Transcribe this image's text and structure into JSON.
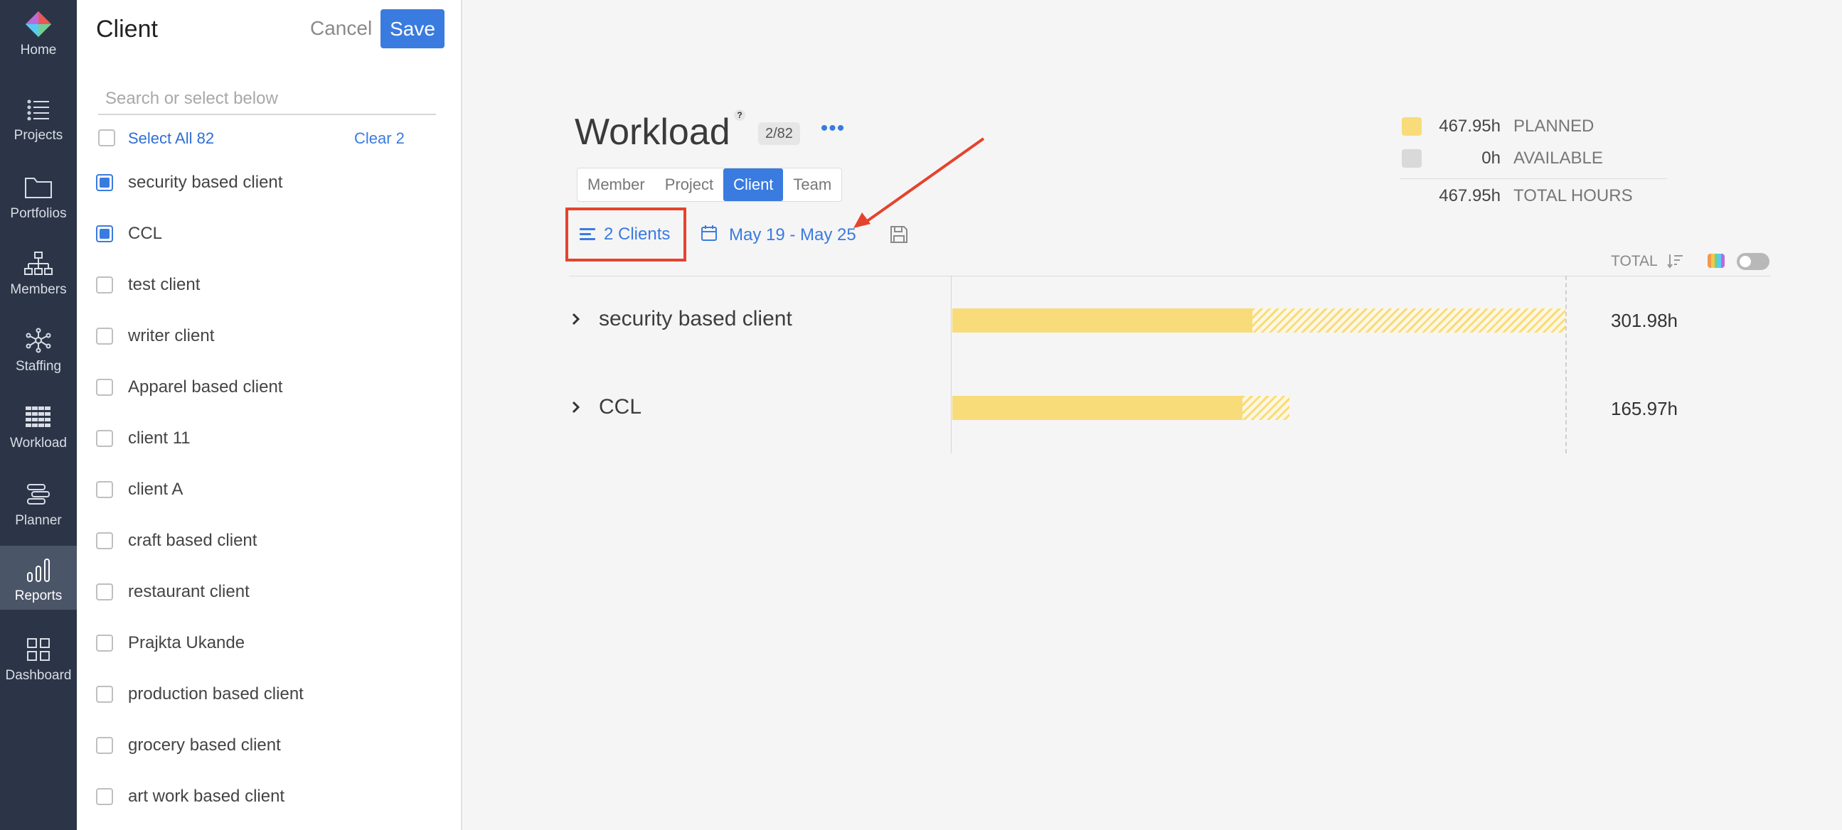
{
  "nav": {
    "items": [
      {
        "label": "Home",
        "icon": "logo-icon"
      },
      {
        "label": "Projects",
        "icon": "list-icon"
      },
      {
        "label": "Portfolios",
        "icon": "folder-icon"
      },
      {
        "label": "Members",
        "icon": "org-chart-icon"
      },
      {
        "label": "Staffing",
        "icon": "network-icon"
      },
      {
        "label": "Workload",
        "icon": "grid-icon"
      },
      {
        "label": "Planner",
        "icon": "planner-icon"
      },
      {
        "label": "Reports",
        "icon": "bar-chart-icon",
        "active": true
      },
      {
        "label": "Dashboard",
        "icon": "dashboard-icon"
      }
    ]
  },
  "panel": {
    "title": "Client",
    "cancel_label": "Cancel",
    "save_label": "Save",
    "search_placeholder": "Search or select below",
    "select_all_label": "Select All 82",
    "clear_label": "Clear 2",
    "clients": [
      {
        "name": "security based client",
        "checked": true
      },
      {
        "name": "CCL",
        "checked": true
      },
      {
        "name": "test client",
        "checked": false
      },
      {
        "name": "writer client",
        "checked": false
      },
      {
        "name": "Apparel based client",
        "checked": false
      },
      {
        "name": "client 11",
        "checked": false
      },
      {
        "name": "client A",
        "checked": false
      },
      {
        "name": "craft based client",
        "checked": false
      },
      {
        "name": "restaurant client",
        "checked": false
      },
      {
        "name": "Prajkta Ukande",
        "checked": false
      },
      {
        "name": "production based client",
        "checked": false
      },
      {
        "name": "grocery based client",
        "checked": false
      },
      {
        "name": "art work based client",
        "checked": false
      }
    ]
  },
  "main": {
    "title": "Workload",
    "help": "?",
    "count_badge": "2/82",
    "more_label": "•••",
    "tabs": [
      {
        "label": "Member",
        "active": false
      },
      {
        "label": "Project",
        "active": false
      },
      {
        "label": "Client",
        "active": true
      },
      {
        "label": "Team",
        "active": false
      }
    ],
    "clients_filter_label": "2 Clients",
    "date_range_label": "May 19 - May 25",
    "legend": {
      "planned_value": "467.95h",
      "planned_label": "PLANNED",
      "available_value": "0h",
      "available_label": "AVAILABLE",
      "total_value": "467.95h",
      "total_label": "TOTAL HOURS"
    },
    "total_column_label": "TOTAL",
    "colors": {
      "planned": "#f8dc7a",
      "available": "#d9d9d9",
      "accent": "#3a7be0",
      "highlight": "#e5432d"
    },
    "rows": [
      {
        "name": "security based client",
        "total": "301.98h",
        "solid_fraction": 0.489,
        "hatch_fraction": 0.511
      },
      {
        "name": "CCL",
        "total": "165.97h",
        "solid_fraction": 0.473,
        "hatch_fraction": 0.076
      }
    ]
  }
}
